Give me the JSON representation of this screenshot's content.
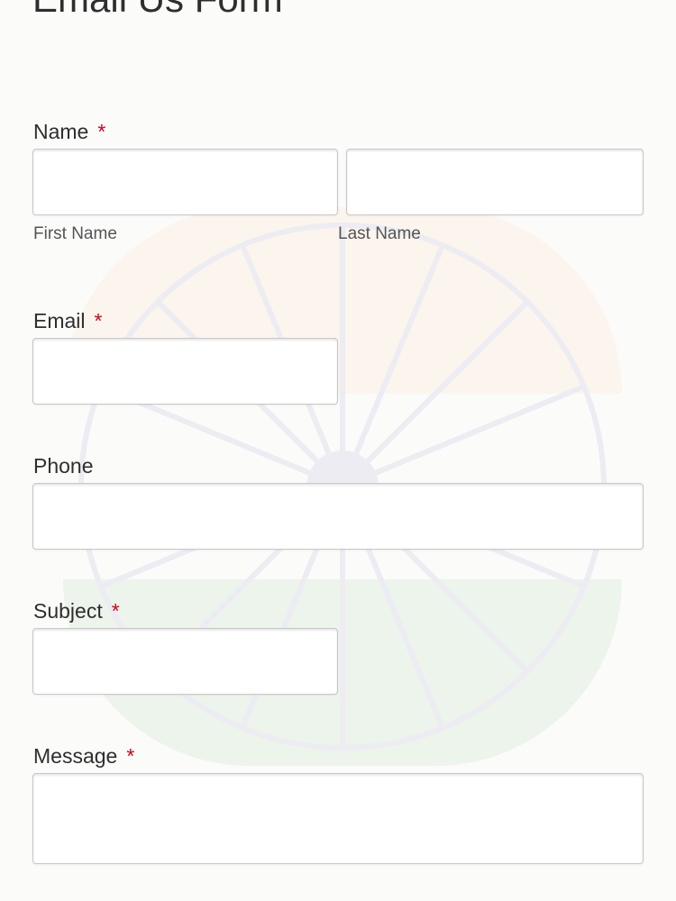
{
  "form": {
    "title": "Email Us Form",
    "required_marker": "*",
    "name": {
      "label": "Name",
      "required": true,
      "first": {
        "sublabel": "First Name",
        "value": "",
        "placeholder": ""
      },
      "last": {
        "sublabel": "Last Name",
        "value": "",
        "placeholder": ""
      }
    },
    "email": {
      "label": "Email",
      "required": true,
      "value": "",
      "placeholder": ""
    },
    "phone": {
      "label": "Phone",
      "required": false,
      "value": "",
      "placeholder": ""
    },
    "subject": {
      "label": "Subject",
      "required": true,
      "value": "",
      "placeholder": ""
    },
    "message": {
      "label": "Message",
      "required": true,
      "value": "",
      "placeholder": ""
    }
  },
  "colors": {
    "background": "#fbfbfa",
    "text": "#2e2e2e",
    "required": "#d0021b",
    "input_border": "#c8c8c8"
  },
  "icons": {
    "watermark": "chakra-emblem-watermark"
  }
}
